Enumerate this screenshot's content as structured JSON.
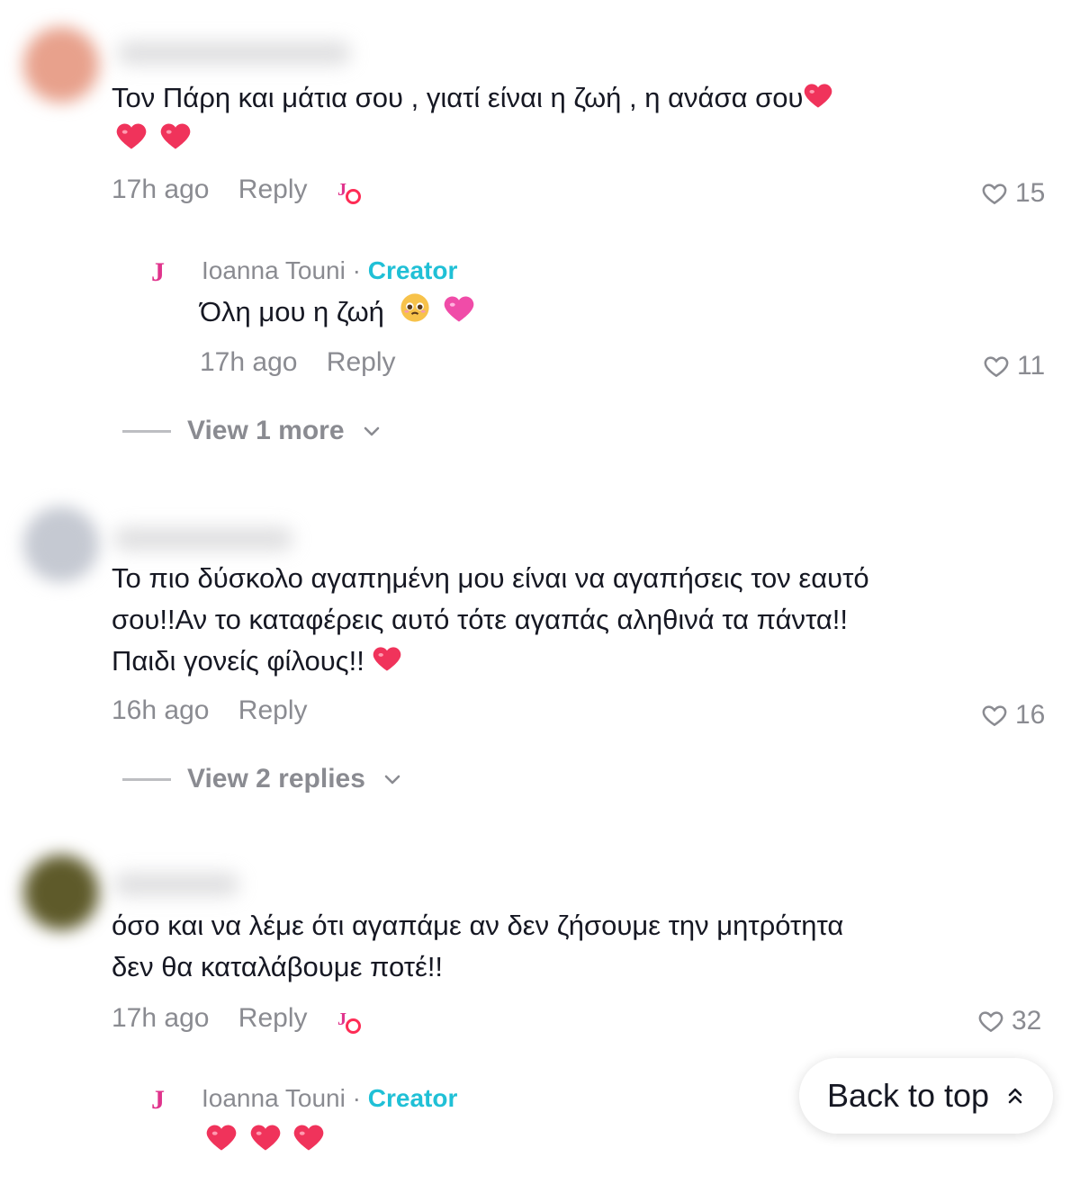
{
  "comments": [
    {
      "text_lines": [
        "Τον Πάρη και μάτια σου , γιατί είναι η ζωή , η ανάσα σου",
        ""
      ],
      "time": "17h ago",
      "reply_label": "Reply",
      "likes": "15",
      "creator_liked": true,
      "avatar_color": "#e8a18c",
      "reply": {
        "author": "Ioanna Touni",
        "separator": "·",
        "badge": "Creator",
        "text": "Όλη μου η ζωή",
        "time": "17h ago",
        "reply_label": "Reply",
        "likes": "11"
      },
      "view_more": "View 1 more"
    },
    {
      "text_lines": [
        "Το πιο δύσκολο αγαπημένη μου είναι να αγαπήσεις τον εαυτό",
        "σου!!Αν το καταφέρεις αυτό τότε αγαπάς αληθινά τα πάντα!!",
        "Παιδι γονείς φίλους!!"
      ],
      "time": "16h ago",
      "reply_label": "Reply",
      "likes": "16",
      "avatar_color": "#c5c9d2",
      "view_more": "View 2 replies"
    },
    {
      "text_lines": [
        "όσο και να λέμε ότι αγαπάμε αν δεν ζήσουμε την μητρότητα",
        "δεν θα καταλάβουμε ποτέ!!"
      ],
      "time": "17h ago",
      "reply_label": "Reply",
      "likes": "32",
      "creator_liked": true,
      "avatar_color": "#5e5a2a",
      "reply": {
        "author": "Ioanna Touni",
        "separator": "·",
        "badge": "Creator"
      }
    }
  ],
  "creator_logo": "J",
  "back_to_top": "Back to top",
  "colors": {
    "accent_creator": "#20c0d6",
    "heart_red": "#fe2c55",
    "muted": "#8a8b91"
  }
}
